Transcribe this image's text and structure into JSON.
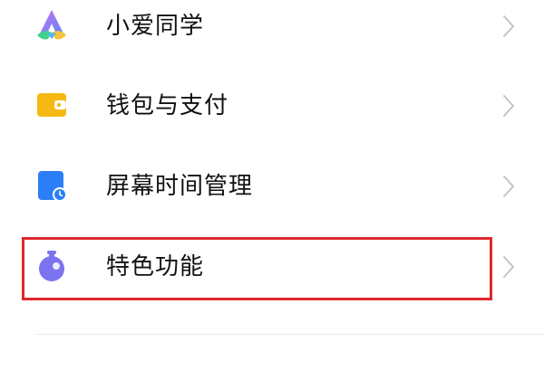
{
  "settings": {
    "items": [
      {
        "label": "小爱同学",
        "icon": "xiaoai-icon"
      },
      {
        "label": "钱包与支付",
        "icon": "wallet-icon"
      },
      {
        "label": "屏幕时间管理",
        "icon": "screen-time-icon"
      },
      {
        "label": "特色功能",
        "icon": "special-features-icon"
      }
    ]
  },
  "colors": {
    "highlight_border": "#e0282d",
    "text": "#111111",
    "chevron": "#c4c4c4",
    "wallet": "#f5b914",
    "screen_time": "#2c7ef8",
    "special_features": "#7c73f0"
  }
}
